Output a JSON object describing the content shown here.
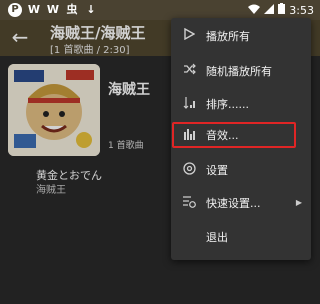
{
  "status_bar": {
    "left_icons": [
      "P",
      "W",
      "W",
      "虫",
      "↓"
    ],
    "time": "3:53"
  },
  "header": {
    "title": "海贼王/海贼王",
    "subtitle": "[1 首歌曲 / 2:30]"
  },
  "album": {
    "name": "海贼王",
    "song_count": "1 首歌曲"
  },
  "song": {
    "title": "黄金とおでん",
    "artist": "海贼王"
  },
  "menu": {
    "items": [
      {
        "label": "播放所有",
        "icon": "play-icon"
      },
      {
        "label": "随机播放所有",
        "icon": "shuffle-icon"
      },
      {
        "label": "排序......",
        "icon": "sort-icon"
      },
      {
        "label": "音效...",
        "icon": "equalizer-icon"
      },
      {
        "label": "设置",
        "icon": "settings-icon"
      },
      {
        "label": "快速设置...",
        "icon": "quick-settings-icon"
      },
      {
        "label": "退出",
        "icon": ""
      }
    ]
  },
  "colors": {
    "toolbar": "#51472f",
    "status_bar": "#4a4231",
    "menu_bg": "#333333",
    "highlight": "#e02525"
  }
}
